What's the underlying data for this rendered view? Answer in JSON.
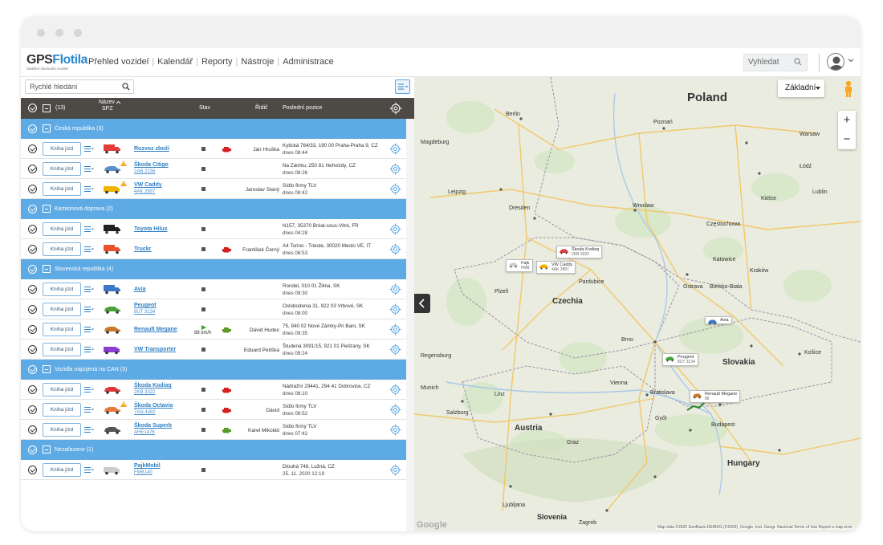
{
  "app": {
    "logo_gps": "GPS",
    "logo_flotila": "Flotila",
    "logo_sub": "Satelitní sledování vozidel"
  },
  "nav": [
    {
      "label": "Přehled vozidel"
    },
    {
      "label": "Kalendář"
    },
    {
      "label": "Reporty"
    },
    {
      "label": "Nástroje"
    },
    {
      "label": "Administrace"
    }
  ],
  "search": {
    "placeholder": "Vyhledat"
  },
  "left": {
    "quick_search": "Rychlé hledání",
    "count": "(13)",
    "col_name": "Název",
    "col_spz": "SPZ",
    "col_state": "Stav",
    "col_driver": "Řidič",
    "col_position": "Poslední pozice",
    "kniha": "Kniha jízd"
  },
  "groups": [
    {
      "name": "Česká republika (3)"
    },
    {
      "name": "Kamionová doprava (2)"
    },
    {
      "name": "Slovenská republika (4)"
    },
    {
      "name": "Vozidla napojená na CAN (3)"
    },
    {
      "name": "Nezařazeno (1)"
    }
  ],
  "vehicles": [
    {
      "name": "Rozvoz zboží",
      "spz": "",
      "driver": "Jan Hruška",
      "pos": "Kytická 764/33, 190 00 Praha-Praha 9, CZ",
      "time": "dnes  08:44",
      "color": "#e23b3b"
    },
    {
      "name": "Škoda Citigo",
      "spz": "2AB 2236",
      "driver": "",
      "pos": "Na Zámku, 250 81 Nehvizdy, CZ",
      "time": "dnes  08:26",
      "color": "#5a8fc8"
    },
    {
      "name": "VW Caddy",
      "spz": "4AK 2897",
      "driver": "Jaroslav Slaný",
      "pos": "Sídlo firmy TLV",
      "time": "dnes  08:42",
      "color": "#f0b400"
    },
    {
      "name": "Toyota Hilux",
      "spz": "",
      "driver": "",
      "pos": "N157, 35370 Bréal-sous-Vitré, FR",
      "time": "dnes  04:28",
      "color": "#222222"
    },
    {
      "name": "Truckr",
      "spz": "",
      "driver": "František Černý",
      "pos": "A4 Torino - Trieste, 30020 Meolo VE, IT",
      "time": "dnes  08:53",
      "color": "#e8532a"
    },
    {
      "name": "Avia",
      "spz": "",
      "driver": "",
      "pos": "Rondel, 010 01 Žilina, SK",
      "time": "dnes  09:30",
      "color": "#3a78c8"
    },
    {
      "name": "Peugeot",
      "spz": "8UT 3134",
      "driver": "",
      "pos": "Oslobodenia 31, 922 03 Vrbové, SK",
      "time": "dnes  08:00",
      "color": "#4aa33a"
    },
    {
      "name": "Renault Megane",
      "spz": "",
      "driver": "Dávid Hudec",
      "pos": "75, 940 02 Nové Zámky-Pri Bani, SK",
      "time": "dnes  09:35",
      "color": "#c97a2a"
    },
    {
      "name": "VW Transporter",
      "spz": "",
      "driver": "Eduard Petiška",
      "pos": "Študená 3091/15, 921 01 Piešťany, SK",
      "time": "dnes  09:24",
      "color": "#8a3fd0"
    },
    {
      "name": "Škoda Kodiaq",
      "spz": "2KB 3322",
      "driver": "",
      "pos": "Nádražní 29441, 294 41 Dobrovice, CZ",
      "time": "dnes  08:10",
      "color": "#d93a3a"
    },
    {
      "name": "Škoda Octavia",
      "spz": "7AN 4382",
      "driver": "Dávid",
      "pos": "Sídlo firmy TLV",
      "time": "dnes  08:52",
      "color": "#e87a3a"
    },
    {
      "name": "Škoda Superb",
      "spz": "AHE1476",
      "driver": "Karel Mikoláš",
      "pos": "Sídlo firmy TLV",
      "time": "dnes  07:42",
      "color": "#555555"
    },
    {
      "name": "PajkMobil",
      "spz": "FMB140",
      "driver": "",
      "pos": "Dlouhá 748, Lužná, CZ",
      "time": "25. 11. 2020  12:19",
      "color": "#cccccc"
    }
  ],
  "speed": "88 km/h",
  "map": {
    "type": "Základní",
    "countries": [
      "Poland",
      "Czechia",
      "Slovakia",
      "Austria",
      "Hungary",
      "Slovenia"
    ],
    "cities": [
      "Berlin",
      "Poznań",
      "Warsaw",
      "Łódź",
      "Leipzig",
      "Dresden",
      "Wrocław",
      "Kraków",
      "Katowice",
      "Ostrava",
      "Brno",
      "Vienna",
      "Bratislava",
      "Budapest",
      "Munich",
      "Graz",
      "Zagreb",
      "Pardubice",
      "Plzeň",
      "Linz",
      "Košice",
      "Częstochowa",
      "Kielce",
      "Lublin",
      "Salzburg",
      "Magdeburg",
      "Regensburg",
      "Bielsko-Biała",
      "Győr",
      "Ljubljana"
    ],
    "vehicle_labels": [
      {
        "name": "Škoda Kodiaq",
        "spz": "2KB 3322"
      },
      {
        "name": "VW Caddy",
        "spz": "4AK 2897"
      },
      {
        "name": "Fajk",
        "spz": "FMB"
      },
      {
        "name": "Avia",
        "spz": ""
      },
      {
        "name": "Peugeot",
        "spz": "8UT 3134"
      },
      {
        "name": "Renault Megane",
        "spz": "88"
      }
    ],
    "credits": "Map data ©2020 GeoBasis-DE/BKG (©2009), Google, Inst. Geogr. Nacional   Terms of Use   Report a map error",
    "google": "Google"
  }
}
